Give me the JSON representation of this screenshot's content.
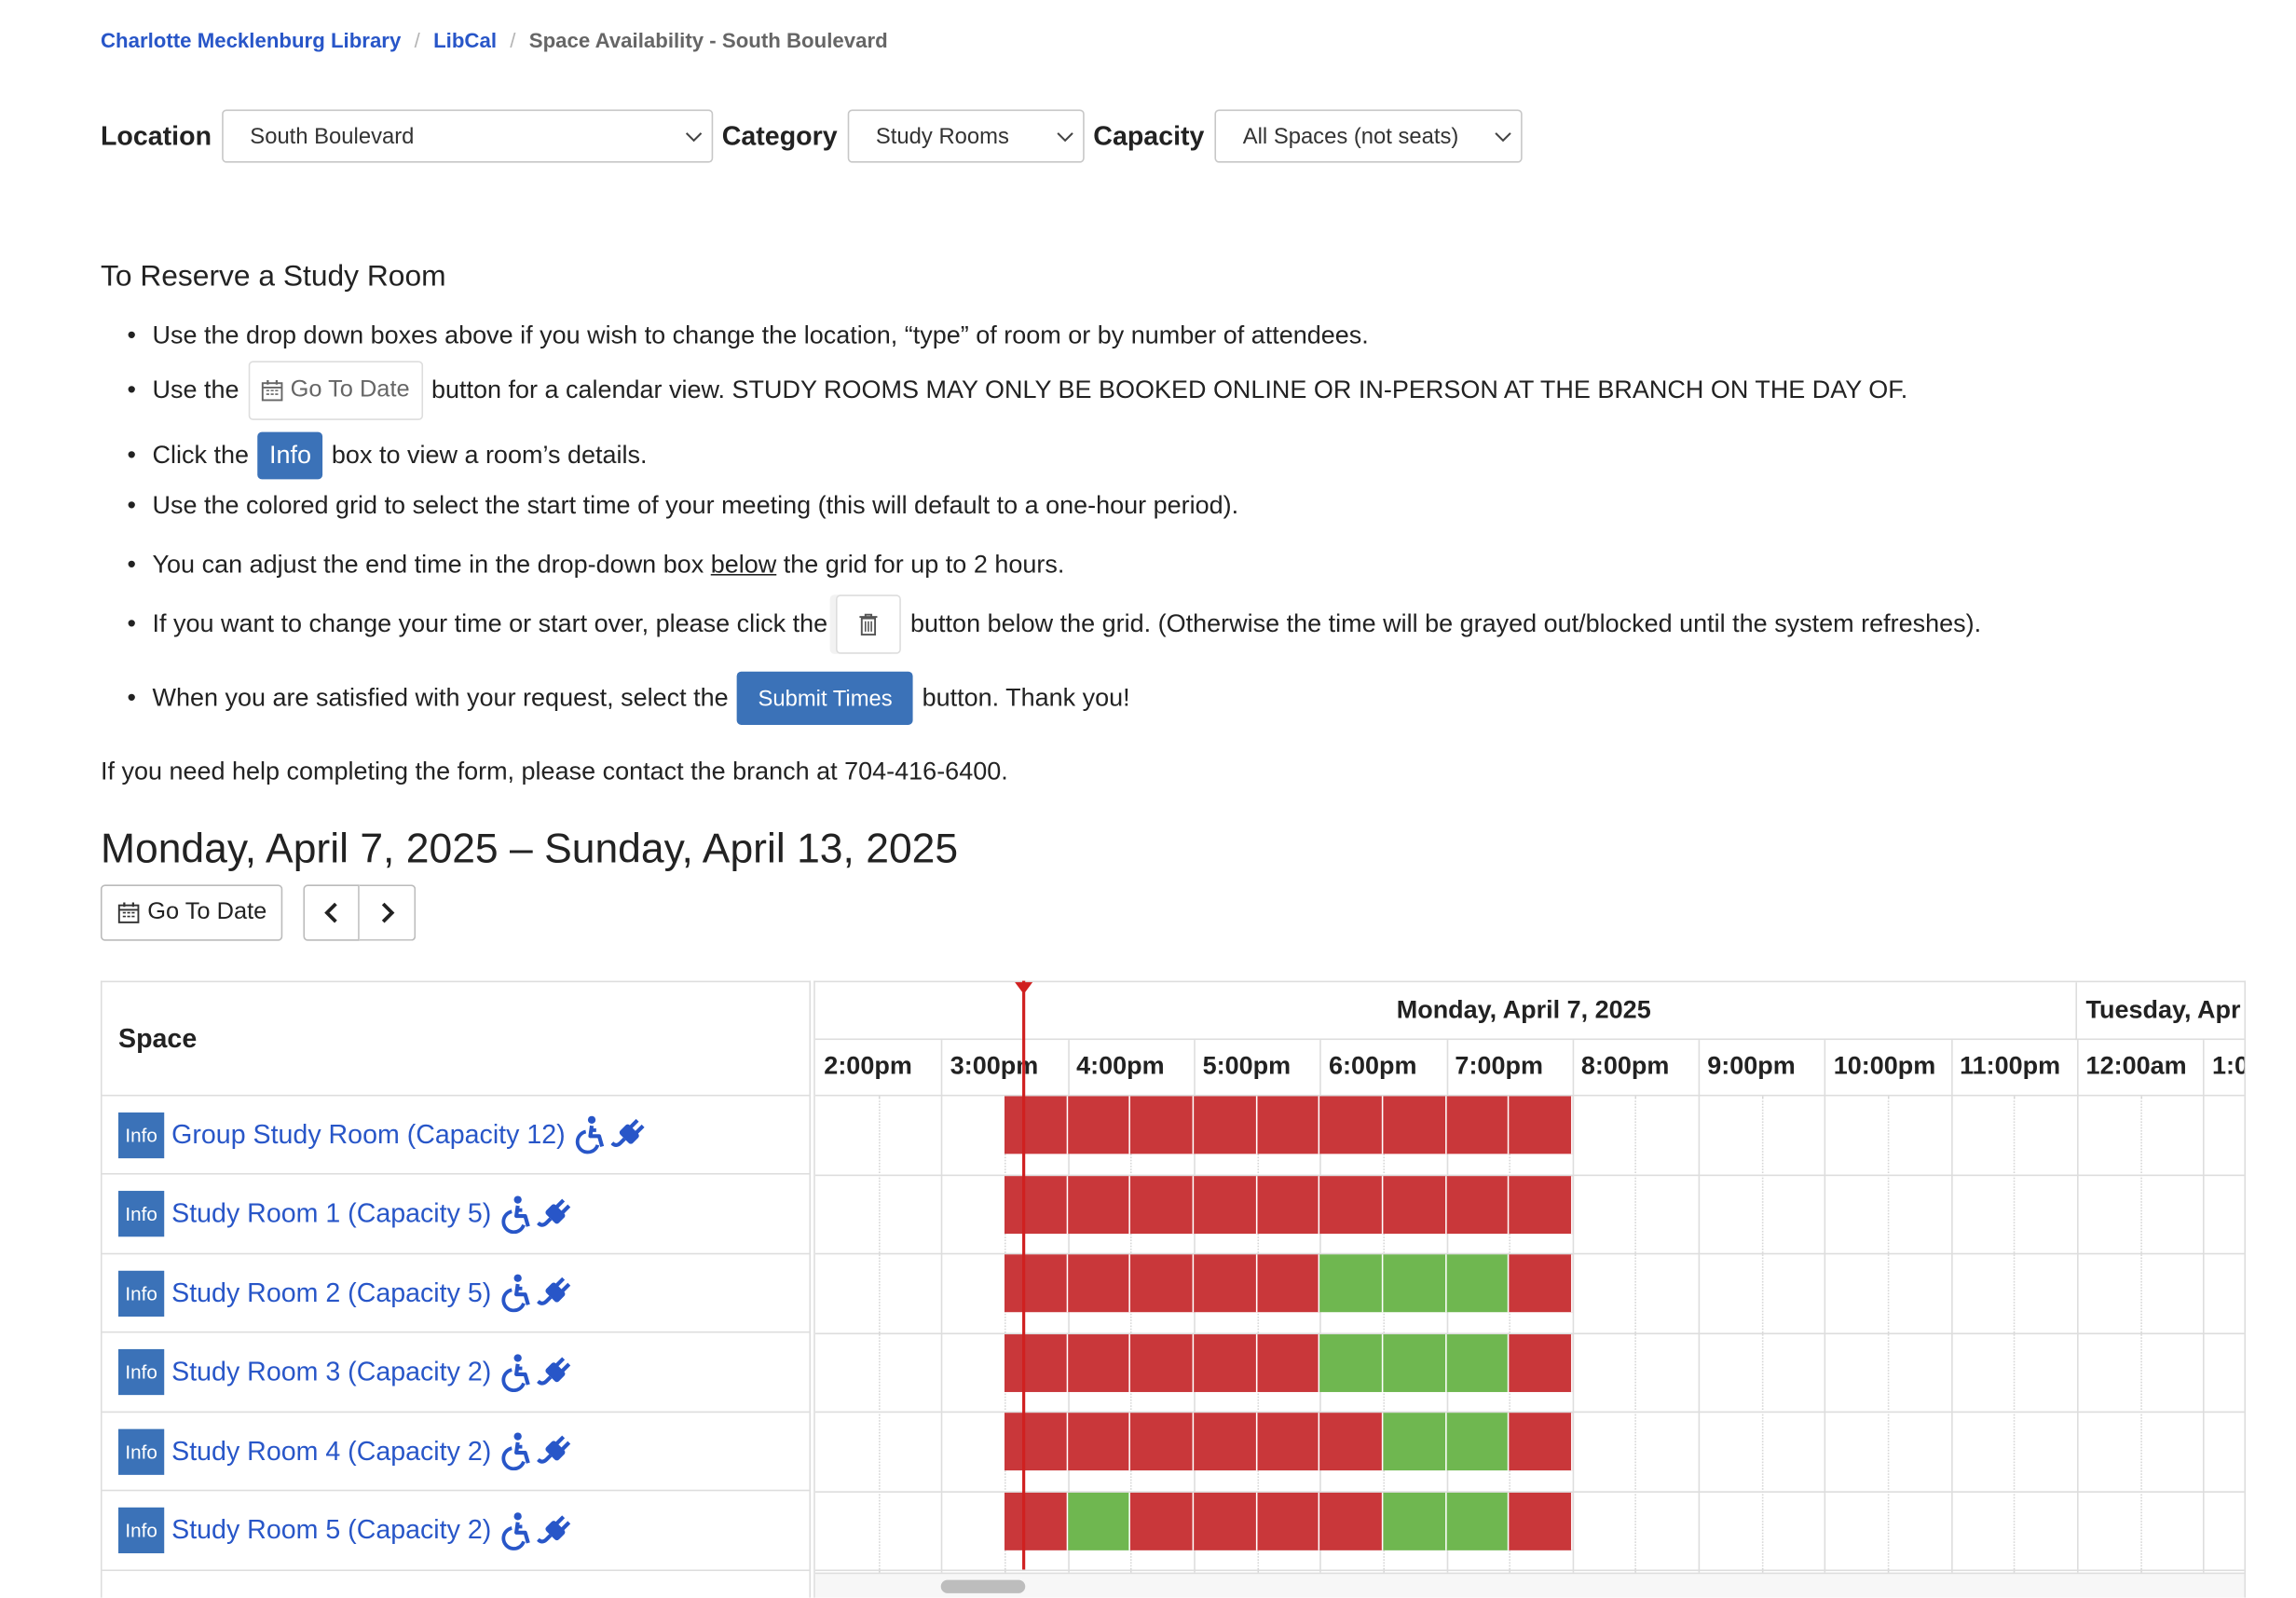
{
  "breadcrumb": {
    "items": [
      "Charlotte Mecklenburg Library",
      "LibCal"
    ],
    "current": "Space Availability - South Boulevard",
    "separator": "/"
  },
  "filters": {
    "location": {
      "label": "Location",
      "value": "South Boulevard"
    },
    "category": {
      "label": "Category",
      "value": "Study Rooms"
    },
    "capacity": {
      "label": "Capacity",
      "value": "All Spaces (not seats)"
    }
  },
  "instructions": {
    "heading": "To Reserve a Study Room",
    "item1": "Use the drop down boxes above if you wish to change the location, “type” of room or by number of attendees.",
    "item2_before": "Use the",
    "item2_button": "Go To Date",
    "item2_after": "button for a calendar view. STUDY ROOMS MAY ONLY BE BOOKED ONLINE OR IN-PERSON AT THE BRANCH ON THE DAY OF.",
    "item3_before": "Click the",
    "item3_button": "Info",
    "item3_after": "box to view a room’s details.",
    "item4": "Use the colored grid to select the start time of your meeting (this will default to a one-hour period).",
    "item5_before": "You can adjust the end time in the drop-down box",
    "item5_underline": "below",
    "item5_after": "the grid for up to 2 hours.",
    "item6_before": "If you want to change your time or start over, please click the",
    "item6_after": "button below the grid. (Otherwise the time will be grayed out/blocked until the system refreshes).",
    "item7_before": "When you are satisfied with your request, select the",
    "item7_button": "Submit Times",
    "item7_after": "button. Thank you!",
    "help": "If you need help completing the form, please contact the branch at 704-416-6400."
  },
  "date_range": "Monday, April 7, 2025 – Sunday, April 13, 2025",
  "toolbar": {
    "goto_label": "Go To Date"
  },
  "grid": {
    "space_header": "Space",
    "day1": "Monday, April 7, 2025",
    "day2": "Tuesday, Apr",
    "hours": [
      "2:00pm",
      "3:00pm",
      "4:00pm",
      "5:00pm",
      "6:00pm",
      "7:00pm",
      "8:00pm",
      "9:00pm",
      "10:00pm",
      "11:00pm",
      "12:00am",
      "1:0"
    ],
    "info_label": "Info",
    "slot_times": [
      "3:30pm",
      "4:00pm",
      "4:30pm",
      "5:00pm",
      "5:30pm",
      "6:00pm",
      "6:30pm",
      "7:00pm",
      "7:30pm"
    ],
    "rooms": [
      {
        "name": "Group Study Room (Capacity 12)",
        "slots": [
          "B",
          "B",
          "B",
          "B",
          "B",
          "B",
          "B",
          "B",
          "B"
        ]
      },
      {
        "name": "Study Room 1 (Capacity 5)",
        "slots": [
          "B",
          "B",
          "B",
          "B",
          "B",
          "B",
          "B",
          "B",
          "B"
        ]
      },
      {
        "name": "Study Room 2 (Capacity 5)",
        "slots": [
          "B",
          "B",
          "B",
          "B",
          "B",
          "A",
          "A",
          "A",
          "B"
        ]
      },
      {
        "name": "Study Room 3 (Capacity 2)",
        "slots": [
          "B",
          "B",
          "B",
          "B",
          "B",
          "A",
          "A",
          "A",
          "B"
        ]
      },
      {
        "name": "Study Room 4 (Capacity 2)",
        "slots": [
          "B",
          "B",
          "B",
          "B",
          "B",
          "B",
          "A",
          "A",
          "B"
        ]
      },
      {
        "name": "Study Room 5 (Capacity 2)",
        "slots": [
          "B",
          "A",
          "B",
          "B",
          "B",
          "B",
          "A",
          "A",
          "B"
        ]
      }
    ]
  },
  "colors": {
    "booked": "#c9373a",
    "available": "#6fb750",
    "link": "#2856c8",
    "button": "#3b72b8",
    "now_marker": "#d02020"
  }
}
